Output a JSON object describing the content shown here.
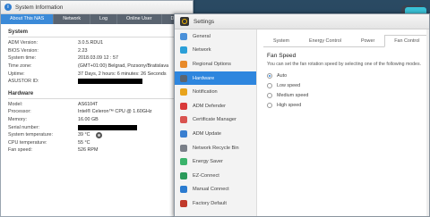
{
  "colors": {
    "accent": "#2e86de",
    "tab_bar": "#5a6470",
    "sidebar_bg": "#f3f3f3"
  },
  "sysinfo": {
    "title": "System Information",
    "tabs": [
      "About This NAS",
      "Network",
      "Log",
      "Online User",
      "Di"
    ],
    "system": {
      "heading": "System",
      "rows": [
        {
          "k": "ADM Version:",
          "v": "3.0.5.RDU1"
        },
        {
          "k": "BIOS Version:",
          "v": "2.23"
        },
        {
          "k": "System time:",
          "v": "2018.03.09   12 : 57"
        },
        {
          "k": "Time zone:",
          "v": "(GMT+01:00) Belgrad, Pozsony/Bratislava"
        },
        {
          "k": "Uptime:",
          "v": "37 Days, 2 hours: 6 minutes: 26 Seconds"
        },
        {
          "k": "ASUSTOR ID:",
          "v": ""
        }
      ]
    },
    "hardware": {
      "heading": "Hardware",
      "rows": [
        {
          "k": "Model:",
          "v": "AS6104T"
        },
        {
          "k": "Processor:",
          "v": "Intel® Celeron™ CPU @ 1.60GHz"
        },
        {
          "k": "Memory:",
          "v": "16.00 GB"
        },
        {
          "k": "Serial number:",
          "v": ""
        },
        {
          "k": "System temperature:",
          "v": "39 °C"
        },
        {
          "k": "CPU temperature:",
          "v": "55 °C"
        },
        {
          "k": "Fan speed:",
          "v": "526 RPM"
        }
      ]
    }
  },
  "settings": {
    "title": "Settings",
    "sidebar": [
      {
        "label": "General",
        "icon": "general-icon",
        "color": "#4a90d9"
      },
      {
        "label": "Network",
        "icon": "network-icon",
        "color": "#2b9fd8"
      },
      {
        "label": "Regional Options",
        "icon": "globe-icon",
        "color": "#e88a2a"
      },
      {
        "label": "Hardware",
        "icon": "hardware-icon",
        "color": "#5a6470"
      },
      {
        "label": "Notification",
        "icon": "notification-icon",
        "color": "#e8a31c"
      },
      {
        "label": "ADM Defender",
        "icon": "shield-icon",
        "color": "#d93a3a"
      },
      {
        "label": "Certificate Manager",
        "icon": "certificate-icon",
        "color": "#d9534f"
      },
      {
        "label": "ADM Update",
        "icon": "update-icon",
        "color": "#3a7fd0"
      },
      {
        "label": "Network Recycle Bin",
        "icon": "recycle-bin-icon",
        "color": "#7a7f88"
      },
      {
        "label": "Energy Saver",
        "icon": "energy-icon",
        "color": "#3ab36b"
      },
      {
        "label": "EZ-Connect",
        "icon": "ez-connect-icon",
        "color": "#2a9a5a"
      },
      {
        "label": "Manual Connect",
        "icon": "manual-connect-icon",
        "color": "#2b7bd0"
      },
      {
        "label": "Factory Default",
        "icon": "factory-default-icon",
        "color": "#c0392b"
      }
    ],
    "active_index": 3,
    "tabs": [
      "System",
      "Energy Control",
      "Power",
      "Fan Control"
    ],
    "active_tab": 3,
    "fan": {
      "heading": "Fan Speed",
      "desc": "You can set the fan rotation speed by selecting one of the following modes.",
      "options": [
        "Auto",
        "Low speed",
        "Medium speed",
        "High speed"
      ],
      "selected": 0
    }
  }
}
